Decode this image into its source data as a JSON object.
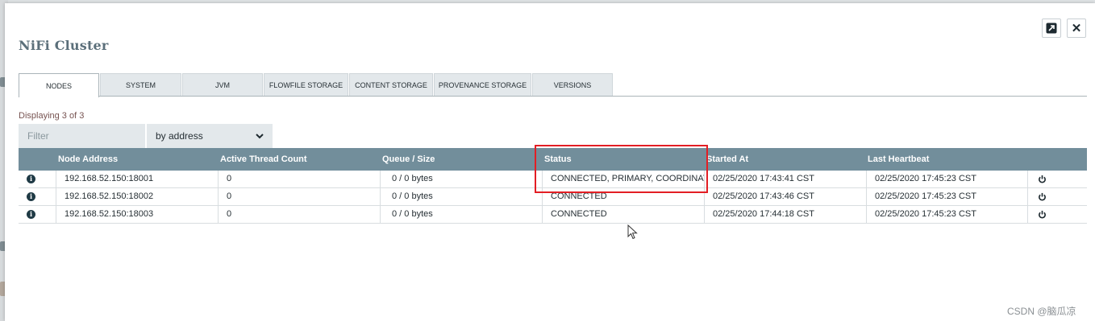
{
  "dialog": {
    "title": "NiFi Cluster",
    "buttons": {
      "maximize_icon": "maximize-icon",
      "close_label": "✕"
    }
  },
  "tabs": [
    {
      "label": "NODES",
      "active": true
    },
    {
      "label": "SYSTEM",
      "active": false
    },
    {
      "label": "JVM",
      "active": false
    },
    {
      "label": "FLOWFILE STORAGE",
      "active": false
    },
    {
      "label": "CONTENT STORAGE",
      "active": false
    },
    {
      "label": "PROVENANCE STORAGE",
      "active": false
    },
    {
      "label": "VERSIONS",
      "active": false
    }
  ],
  "displaying": "Displaying 3 of 3",
  "filter": {
    "placeholder": "Filter",
    "value": "",
    "by_selected": "by address"
  },
  "table": {
    "columns": [
      "Node Address",
      "Active Thread Count",
      "Queue / Size",
      "Status",
      "Started At",
      "Last Heartbeat"
    ],
    "rows": [
      {
        "address": "192.168.52.150:18001",
        "threads": "0",
        "queue": "0 / 0 bytes",
        "status": "CONNECTED, PRIMARY, COORDINAT...",
        "started": "02/25/2020 17:43:41 CST",
        "heartbeat": "02/25/2020 17:45:23 CST"
      },
      {
        "address": "192.168.52.150:18002",
        "threads": "0",
        "queue": "0 / 0 bytes",
        "status": "CONNECTED",
        "started": "02/25/2020 17:43:46 CST",
        "heartbeat": "02/25/2020 17:45:23 CST"
      },
      {
        "address": "192.168.52.150:18003",
        "threads": "0",
        "queue": "0 / 0 bytes",
        "status": "CONNECTED",
        "started": "02/25/2020 17:44:18 CST",
        "heartbeat": "02/25/2020 17:45:23 CST"
      }
    ]
  },
  "watermark": "CSDN @脑瓜凉",
  "colors": {
    "header_bg": "#728e9b",
    "highlight": "#e31e24",
    "title": "#5b6f7a",
    "displaying": "#775351"
  }
}
